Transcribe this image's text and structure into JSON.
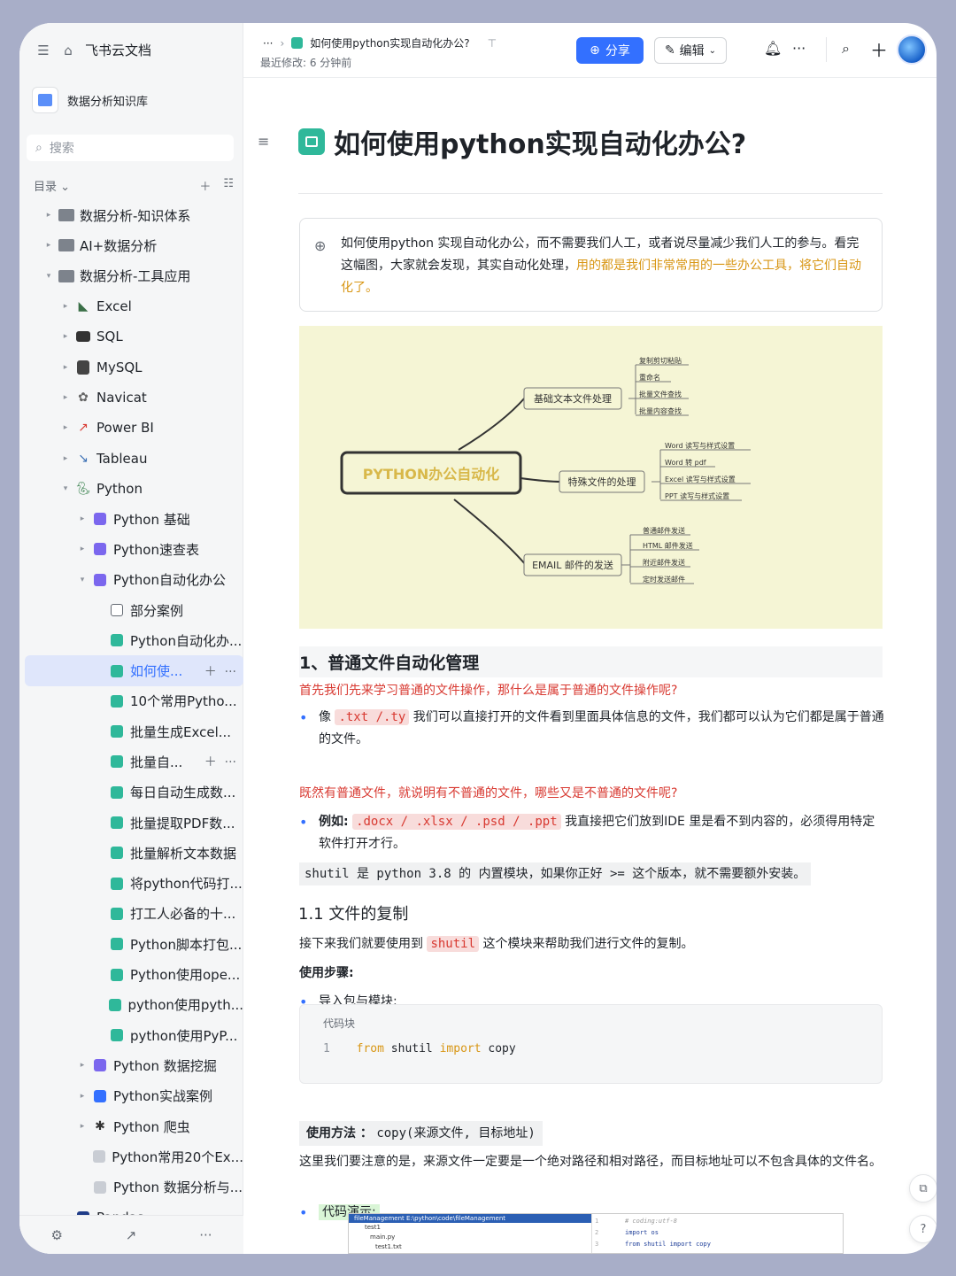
{
  "app": {
    "title": "飞书云文档"
  },
  "knowledge_base": {
    "name": "数据分析知识库"
  },
  "search": {
    "placeholder": "搜索"
  },
  "toc": {
    "label": "目录 ⌄"
  },
  "tree": [
    {
      "label": "数据分析-知识体系",
      "level": 0,
      "caret": "▸",
      "icon": "folder-icon"
    },
    {
      "label": "AI+数据分析",
      "level": 0,
      "caret": "▸",
      "icon": "folder-icon"
    },
    {
      "label": "数据分析-工具应用",
      "level": 0,
      "caret": "▾",
      "icon": "folder-icon"
    },
    {
      "label": "Excel",
      "level": 1,
      "caret": "▸",
      "icon": "excel-icon"
    },
    {
      "label": "SQL",
      "level": 1,
      "caret": "▸",
      "icon": "sql-icon"
    },
    {
      "label": "MySQL",
      "level": 1,
      "caret": "▸",
      "icon": "mysql-icon"
    },
    {
      "label": "Navicat",
      "level": 1,
      "caret": "▸",
      "icon": "navicat-icon"
    },
    {
      "label": "Power BI",
      "level": 1,
      "caret": "▸",
      "icon": "powerbi-icon"
    },
    {
      "label": "Tableau",
      "level": 1,
      "caret": "▸",
      "icon": "tableau-icon"
    },
    {
      "label": "Python",
      "level": 1,
      "caret": "▾",
      "icon": "python-icon"
    },
    {
      "label": "Python 基础",
      "level": 2,
      "caret": "▸",
      "icon": "doc-purple-icon"
    },
    {
      "label": "Python速查表",
      "level": 2,
      "caret": "▸",
      "icon": "doc-purple-icon"
    },
    {
      "label": "Python自动化办公",
      "level": 2,
      "caret": "▾",
      "icon": "doc-purple-icon"
    },
    {
      "label": "部分案例",
      "level": 3,
      "caret": "",
      "icon": "doc-outline-icon"
    },
    {
      "label": "Python自动化办...",
      "level": 3,
      "caret": "",
      "icon": "doc-green-icon"
    },
    {
      "label": "如何使...",
      "level": 3,
      "caret": "",
      "icon": "doc-green-icon",
      "active": true
    },
    {
      "label": "10个常用Pytho...",
      "level": 3,
      "caret": "",
      "icon": "doc-green-icon"
    },
    {
      "label": "批量生成Excel...",
      "level": 3,
      "caret": "",
      "icon": "doc-green-icon"
    },
    {
      "label": "批量自...",
      "level": 3,
      "caret": "",
      "icon": "doc-green-icon",
      "hover": true
    },
    {
      "label": "每日自动生成数...",
      "level": 3,
      "caret": "",
      "icon": "doc-green-icon"
    },
    {
      "label": "批量提取PDF数...",
      "level": 3,
      "caret": "",
      "icon": "doc-green-icon"
    },
    {
      "label": "批量解析文本数据",
      "level": 3,
      "caret": "",
      "icon": "doc-green-icon"
    },
    {
      "label": "将python代码打...",
      "level": 3,
      "caret": "",
      "icon": "doc-green-icon"
    },
    {
      "label": "打工人必备的十...",
      "level": 3,
      "caret": "",
      "icon": "doc-green-icon"
    },
    {
      "label": "Python脚本打包...",
      "level": 3,
      "caret": "",
      "icon": "doc-green-icon"
    },
    {
      "label": "Python使用ope...",
      "level": 3,
      "caret": "",
      "icon": "doc-green-icon"
    },
    {
      "label": "python使用pyth...",
      "level": 3,
      "caret": "",
      "icon": "doc-green-icon"
    },
    {
      "label": "python使用PyP...",
      "level": 3,
      "caret": "",
      "icon": "doc-green-icon"
    },
    {
      "label": "Python 数据挖掘",
      "level": 2,
      "caret": "▸",
      "icon": "doc-purple-icon"
    },
    {
      "label": "Python实战案例",
      "level": 2,
      "caret": "▸",
      "icon": "doc-blue-icon"
    },
    {
      "label": "Python 爬虫",
      "level": 2,
      "caret": "▸",
      "icon": "spider-icon"
    },
    {
      "label": "Python常用20个Ex...",
      "level": 2,
      "caret": "",
      "icon": "doc-gray-icon"
    },
    {
      "label": "Python 数据分析与...",
      "level": 2,
      "caret": "",
      "icon": "doc-gray-icon"
    },
    {
      "label": "Pandas",
      "level": 1,
      "caret": "▸",
      "icon": "pandas-icon"
    }
  ],
  "header": {
    "breadcrumb_more": "···",
    "doc_title": "如何使用python实现自动化办公?",
    "last_modified": "最近修改: 6 分钟前",
    "share_label": "分享",
    "edit_label": "编辑"
  },
  "doc": {
    "title": "如何使用python实现自动化办公?",
    "callout_1": "如何使用python 实现自动化办公，而不需要我们人工，或者说尽量减少我们人工的参与。看完这幅图，大家就会发现，其实自动化处理，",
    "callout_2": "用的都是我们非常常用的一些办公工具，将它们自动化了。",
    "mindmap": {
      "root": "PYTHON办公自动化",
      "branches": [
        {
          "label": "基础文本文件处理",
          "leaves": [
            "复制剪切粘贴",
            "重命名",
            "批量文件查找",
            "批量内容查找"
          ]
        },
        {
          "label": "特殊文件的处理",
          "leaves": [
            "Word 读写与样式设置",
            "Word 转 pdf",
            "Excel 读写与样式设置",
            "PPT 读写与样式设置"
          ]
        },
        {
          "label": "EMAIL 邮件的发送",
          "leaves": [
            "普通邮件发送",
            "HTML 邮件发送",
            "附近邮件发送",
            "定时发送邮件"
          ]
        }
      ]
    },
    "h1": "1、普通文件自动化管理",
    "q1": "首先我们先来学习普通的文件操作，那什么是属于普通的文件操作呢?",
    "b1_pre": "像",
    "b1_code": ".txt /.ty",
    "b1_post": "我们可以直接打开的文件看到里面具体信息的文件，我们都可以认为它们都是属于普通的文件。",
    "q2": "既然有普通文件，就说明有不普通的文件，哪些又是不普通的文件呢?",
    "b2_bold": "例如:",
    "b2_code": ".docx / .xlsx / .psd / .ppt",
    "b2_post": "我直接把它们放到IDE 里是看不到内容的，必须得用特定软件打开才行。",
    "note": "shutil 是 python 3.8 的 内置模块，如果你正好 >= 这个版本，就不需要额外安装。",
    "h2": "1.1 文件的复制",
    "p1_pre": "接下来我们就要使用到",
    "p1_code": "shutil",
    "p1_post": "这个模块来帮助我们进行文件的复制。",
    "steps": "使用步骤:",
    "b3": "导入包与模块:",
    "code_label": "代码块",
    "code_line_no": "1",
    "code_from": "from",
    "code_mod": "shutil",
    "code_import": "import",
    "code_name": "copy",
    "usage_bold": "使用方法 ：",
    "usage_code": "copy(来源文件, 目标地址)",
    "p2": "这里我们要注意的是，来源文件一定要是一个绝对路径和相对路径，而目标地址可以不包含具体的文件名。",
    "b4": "代码演示:",
    "shot_title": "fileManagement  E:\\python\\code\\fileManagement",
    "shot_items": [
      "test1",
      "main.py",
      "test1.txt"
    ],
    "shot_code": [
      "# coding:utf-8",
      "import os",
      "from shutil import copy"
    ],
    "shot_line_nos": [
      "1",
      "2",
      "3"
    ]
  },
  "colors": {
    "accent": "#3370ff",
    "red": "#d83931",
    "orange": "#d89614",
    "mindmap_bg": "#f5f5d5"
  }
}
